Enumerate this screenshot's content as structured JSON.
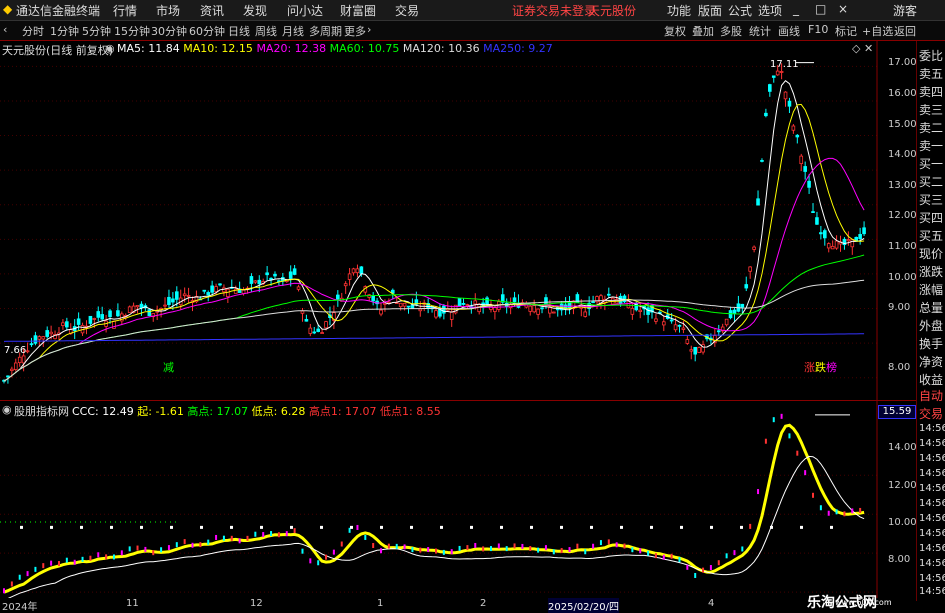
{
  "window": {
    "app_name": "通达信金融终端",
    "menus": [
      "行情",
      "市场",
      "资讯",
      "发现",
      "问小达",
      "财富圈",
      "交易"
    ],
    "login_notice": "证券交易未登录",
    "stock_name_title": "天元股份",
    "right_menus": [
      "功能",
      "版面",
      "公式",
      "选项"
    ],
    "guest": "游客",
    "controls": [
      "_",
      "□",
      "×"
    ]
  },
  "toolbar": {
    "periods": [
      "分时",
      "1分钟",
      "5分钟",
      "15分钟",
      "30分钟",
      "60分钟",
      "日线",
      "周线",
      "月线",
      "多周期",
      "更多"
    ],
    "selected_period": "日线",
    "right_buttons": [
      "复权",
      "叠加",
      "多股",
      "统计",
      "画线",
      "F10",
      "标记",
      "+自选",
      "返回"
    ]
  },
  "main_panel": {
    "title": "天元股份(日线 前复权)",
    "ma_labels": [
      {
        "text": "MA5: 11.84",
        "color": "#ffffff"
      },
      {
        "text": "MA10: 12.15",
        "color": "#ffff00"
      },
      {
        "text": "MA20: 12.38",
        "color": "#ff00ff"
      },
      {
        "text": "MA60: 10.75",
        "color": "#00ff00"
      },
      {
        "text": "MA120: 10.36",
        "color": "#dddddd"
      },
      {
        "text": "MA250: 9.27",
        "color": "#3333ff"
      }
    ],
    "y_ticks": [
      "17.00",
      "16.00",
      "15.00",
      "14.00",
      "13.00",
      "12.00",
      "11.00",
      "10.00",
      "9.00",
      "8.00"
    ],
    "high_label": "17.11",
    "low_label": "7.66",
    "marker_left": "减",
    "marker_right": "涨",
    "marker_right2": "跌",
    "marker_right3": "榜"
  },
  "indicator_panel": {
    "title": "股朋指标网",
    "values": [
      {
        "text": "CCC: 12.49",
        "color": "#ffffff"
      },
      {
        "text": "起: -1.61",
        "color": "#ffff00"
      },
      {
        "text": "高点: 17.07",
        "color": "#00ff00"
      },
      {
        "text": "低点: 6.28",
        "color": "#ffff00"
      },
      {
        "text": "高点1: 17.07",
        "color": "#ff3333"
      },
      {
        "text": "低点1: 8.55",
        "color": "#ff3333"
      }
    ],
    "y_ticks": [
      "14.00",
      "12.00",
      "10.00",
      "8.00"
    ],
    "current_value": "15.59"
  },
  "right_column": {
    "items": [
      "委比",
      "卖五",
      "卖四",
      "卖三",
      "卖二",
      "卖一",
      "买一",
      "买二",
      "买三",
      "买四",
      "买五",
      "现价",
      "涨跌",
      "涨幅",
      "总量",
      "外盘",
      "换手",
      "净资",
      "收益"
    ],
    "auto_trade": [
      "自动",
      "交易"
    ],
    "time_labels": [
      "14:56",
      "14:56",
      "14:56",
      "14:56",
      "14:56",
      "14:56",
      "14:56",
      "14:56",
      "14:56",
      "14:56",
      "14:56",
      "14:56"
    ]
  },
  "x_axis": {
    "labels": [
      "2024年",
      "11",
      "12",
      "1",
      "2",
      "2025/02/20/四",
      "4"
    ]
  },
  "watermark": {
    "line1": "乐淘公式网",
    "line2": "www.60lt.com"
  },
  "chart_data": [
    {
      "type": "candlestick",
      "title": "天元股份(日线 前复权)",
      "ylim": [
        7.5,
        17.3
      ],
      "series": [
        {
          "name": "MA5",
          "color": "#ffffff"
        },
        {
          "name": "MA10",
          "color": "#ffff00"
        },
        {
          "name": "MA20",
          "color": "#ff00ff"
        },
        {
          "name": "MA60",
          "color": "#00ff00"
        },
        {
          "name": "MA120",
          "color": "#dddddd"
        },
        {
          "name": "MA250",
          "color": "#3333ff"
        }
      ],
      "close_path": [
        7.9,
        8.4,
        8.9,
        9.2,
        9.3,
        9.5,
        9.4,
        9.6,
        9.8,
        9.7,
        9.9,
        10.1,
        9.9,
        10.0,
        10.2,
        10.4,
        10.3,
        10.5,
        10.6,
        10.6,
        10.5,
        10.8,
        10.9,
        10.7,
        11.0,
        9.5,
        9.3,
        9.8,
        10.5,
        11.4,
        10.6,
        9.9,
        10.4,
        10.1,
        10.0,
        10.1,
        9.9,
        10.0,
        10.2,
        10.1,
        10.0,
        10.1,
        10.1,
        10.2,
        10.1,
        10.0,
        9.9,
        10.1,
        10.0,
        10.3,
        10.4,
        10.2,
        10.0,
        9.9,
        9.8,
        9.6,
        9.4,
        8.6,
        9.0,
        9.4,
        9.8,
        10.0,
        12.0,
        16.0,
        17.1,
        15.5,
        14.2,
        12.5,
        12.0,
        11.8,
        11.9,
        12.2
      ]
    },
    {
      "type": "line",
      "title": "股朋指标网",
      "ylim": [
        7.8,
        17.4
      ],
      "series": [
        {
          "name": "CCC",
          "color": "#ffffff"
        }
      ]
    }
  ]
}
